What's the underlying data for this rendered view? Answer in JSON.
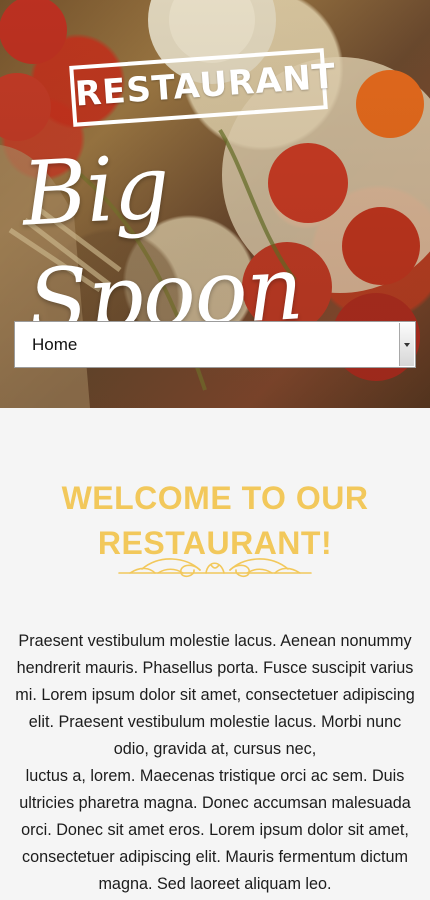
{
  "hero": {
    "label": "RESTAURANT",
    "name": "Big Spoon"
  },
  "navigation": {
    "selected": "Home"
  },
  "main": {
    "heading": "WELCOME TO OUR RESTAURANT!",
    "paragraph": "Praesent vestibulum molestie lacus. Aenean nonummy hendrerit mauris. Phasellus porta. Fusce suscipit varius mi. Lorem ipsum dolor sit amet, consectetuer adipiscing elit. Praesent vestibulum molestie lacus. Morbi nunc odio, gravida at, cursus nec,\nluctus a, lorem. Maecenas tristique orci ac sem. Duis ultricies pharetra magna. Donec accumsan malesuada orci. Donec sit amet eros. Lorem ipsum dolor sit amet, consectetuer adipiscing elit. Mauris fermentum dictum magna. Sed laoreet aliquam leo."
  },
  "colors": {
    "accent": "#f2c85b",
    "background": "#f5f5f5"
  },
  "icons": {
    "dropdown": "chevron-down-icon",
    "ornament": "decorative-divider-icon"
  }
}
